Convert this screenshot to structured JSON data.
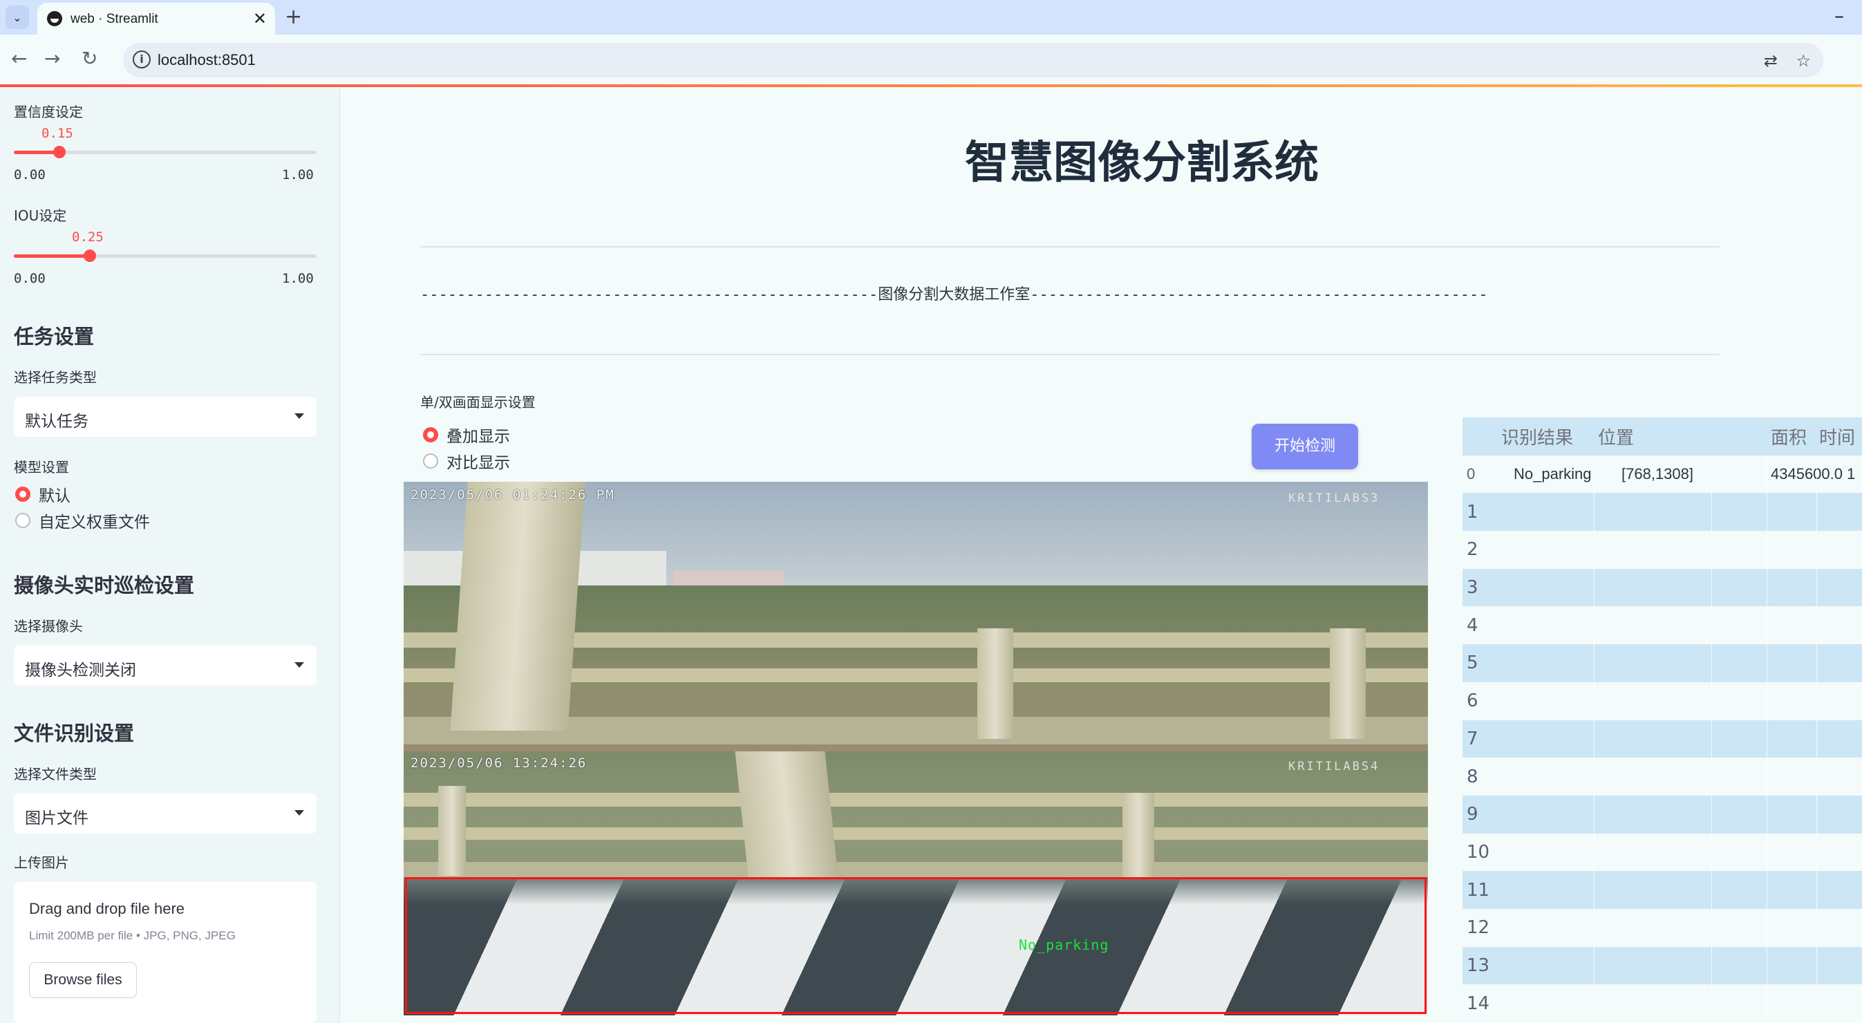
{
  "browser": {
    "tab_title": "web · Streamlit",
    "url": "localhost:8501"
  },
  "sidebar": {
    "conf": {
      "label": "置信度设定",
      "value": "0.15",
      "fraction": 0.15,
      "min": "0.00",
      "max": "1.00"
    },
    "iou": {
      "label": "IOU设定",
      "value": "0.25",
      "fraction": 0.25,
      "min": "0.00",
      "max": "1.00"
    },
    "task_heading": "任务设置",
    "task_type_label": "选择任务类型",
    "task_type_value": "默认任务",
    "model_label": "模型设置",
    "model_options": [
      "默认",
      "自定义权重文件"
    ],
    "camera_heading": "摄像头实时巡检设置",
    "camera_label": "选择摄像头",
    "camera_value": "摄像头检测关闭",
    "file_heading": "文件识别设置",
    "file_type_label": "选择文件类型",
    "file_type_value": "图片文件",
    "upload_label": "上传图片",
    "upload_title": "Drag and drop file here",
    "upload_limit": "Limit 200MB per file • JPG, PNG, JPEG",
    "upload_button": "Browse files"
  },
  "main": {
    "title": "智慧图像分割系统",
    "studio": "--------------------------------------------------图像分割大数据工作室--------------------------------------------------",
    "mode_label": "单/双画面显示设置",
    "mode_options": [
      "叠加显示",
      "对比显示"
    ],
    "start_button": "开始检测",
    "image": {
      "timestamp_top": "2023/05/06 01:24:26 PM",
      "watermark_top": "KRITILABS3",
      "timestamp_bottom": "2023/05/06 13:24:26",
      "watermark_bottom": "KRITILABS4",
      "detection_label": "No_parking"
    }
  },
  "table": {
    "headers": [
      "识别结果",
      "位置",
      "面积",
      "时间"
    ],
    "rows": [
      {
        "index": "0",
        "result": "No_parking",
        "position": "[768,1308]",
        "area": "4345600.0",
        "time": "1"
      },
      {
        "index": "1"
      },
      {
        "index": "2"
      },
      {
        "index": "3"
      },
      {
        "index": "4"
      },
      {
        "index": "5"
      },
      {
        "index": "6"
      },
      {
        "index": "7"
      },
      {
        "index": "8"
      },
      {
        "index": "9"
      },
      {
        "index": "10"
      },
      {
        "index": "11"
      },
      {
        "index": "12"
      },
      {
        "index": "13"
      },
      {
        "index": "14"
      }
    ]
  },
  "colors": {
    "accent": "#ff4b4b",
    "button": "#7f8af4",
    "table_stripe": "#cde6f5",
    "detection_box": "#ff1414",
    "detection_text": "#19e23c"
  }
}
